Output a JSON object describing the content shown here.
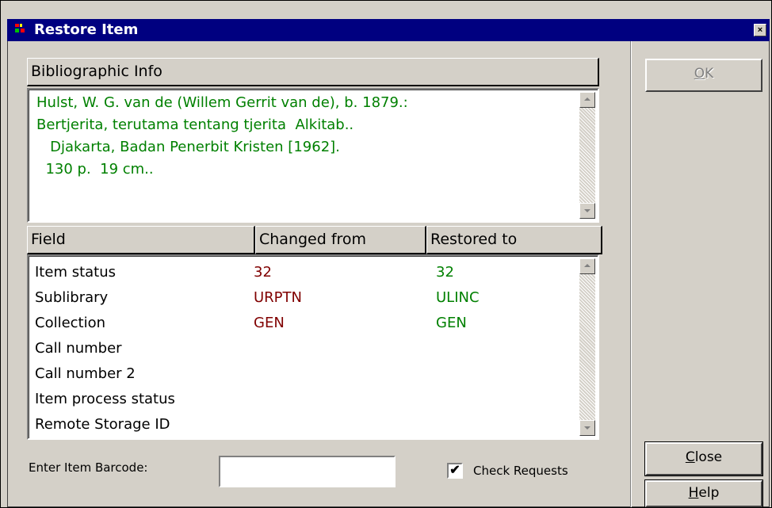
{
  "window": {
    "title": "Restore Item",
    "close_glyph": "×"
  },
  "bibliographic": {
    "header": "Bibliographic Info",
    "lines": [
      "Hulst, W. G. van de (Willem Gerrit van de), b. 1879.:",
      "Bertjerita, terutama tentang tjerita  Alkitab..",
      "   Djakarta, Badan Penerbit Kristen [1962].",
      "  130 p.  19 cm.."
    ]
  },
  "fields_table": {
    "columns": [
      "Field",
      "Changed from",
      "Restored to"
    ],
    "rows": [
      {
        "field": "Item status",
        "from": "32",
        "to": "32"
      },
      {
        "field": "Sublibrary",
        "from": "URPTN",
        "to": "ULINC"
      },
      {
        "field": "Collection",
        "from": "GEN",
        "to": "GEN"
      },
      {
        "field": "Call number",
        "from": "",
        "to": ""
      },
      {
        "field": "Call number 2",
        "from": "",
        "to": ""
      },
      {
        "field": "Item process status",
        "from": "",
        "to": ""
      },
      {
        "field": "Remote Storage ID",
        "from": "",
        "to": ""
      }
    ]
  },
  "barcode": {
    "label": "Enter Item Barcode:",
    "value": ""
  },
  "check_requests": {
    "label": "Check Requests",
    "checked": true,
    "check_glyph": "✔"
  },
  "buttons": {
    "ok": {
      "accel": "O",
      "rest": "K"
    },
    "close": {
      "accel": "C",
      "rest": "lose"
    },
    "help": {
      "accel": "H",
      "rest": "elp"
    }
  },
  "colors": {
    "title_bar": "#000080",
    "bib_text": "#008000",
    "changed_from": "#800000",
    "restored_to": "#008000"
  },
  "icons": [
    "app-icon",
    "close-icon",
    "scroll-up-icon",
    "scroll-down-icon",
    "checkmark-icon"
  ]
}
